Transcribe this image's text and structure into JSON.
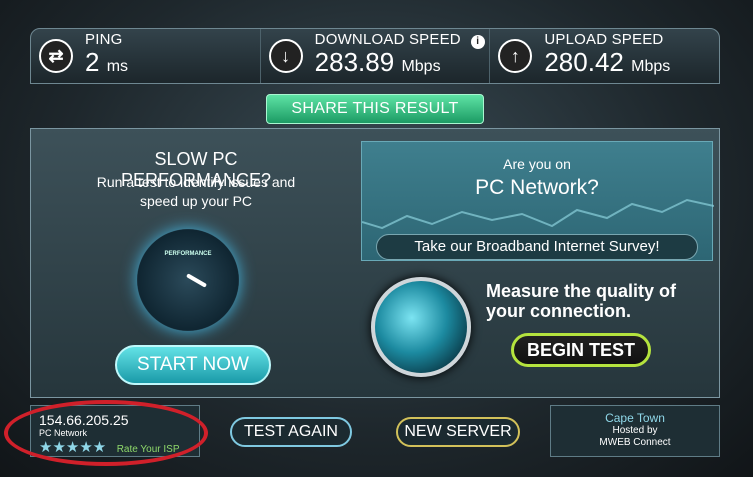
{
  "stats": {
    "ping": {
      "label": "PING",
      "value": "2",
      "unit": "ms"
    },
    "download": {
      "label": "DOWNLOAD SPEED",
      "value": "283.89",
      "unit": "Mbps"
    },
    "upload": {
      "label": "UPLOAD SPEED",
      "value": "280.42",
      "unit": "Mbps"
    }
  },
  "share_label": "SHARE THIS RESULT",
  "pc_ad": {
    "title": "SLOW PC PERFORMANCE?",
    "subtitle": "Run a test to identify issues and speed up your PC",
    "gauge_label": "PERFORMANCE",
    "start_label": "START NOW"
  },
  "survey": {
    "line1": "Are you on",
    "line2": "PC Network?",
    "button": "Take our Broadband Internet Survey!"
  },
  "measure": {
    "text": "Measure the quality of your connection.",
    "button": "BEGIN TEST"
  },
  "isp": {
    "ip": "154.66.205.25",
    "name": "PC Network",
    "stars": "★★★★★",
    "rate_label": "Rate Your ISP"
  },
  "test_again_label": "TEST AGAIN",
  "new_server_label": "NEW SERVER",
  "server": {
    "city": "Cape Town",
    "hosted_by": "Hosted by",
    "host": "MWEB Connect"
  },
  "colors": {
    "accent_green": "#1c9b64",
    "annotation_red": "#d0202a",
    "begin_border": "#b5e33e"
  }
}
